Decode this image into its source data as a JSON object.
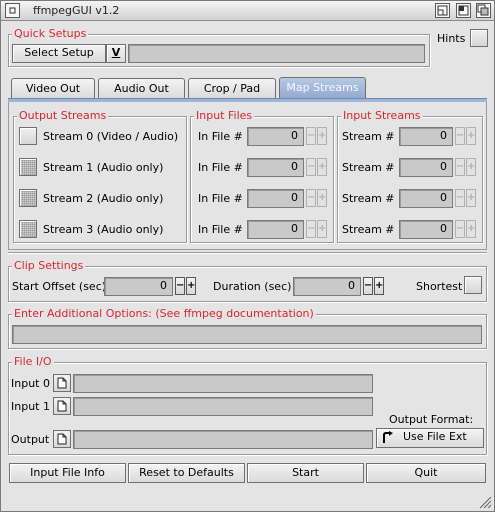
{
  "window": {
    "title": "ffmpegGUI  v1.2"
  },
  "quick_setups": {
    "title": "Quick Setups",
    "select_label": "Select Setup",
    "select_arrow": "V",
    "setup_value": "",
    "hints_label": "Hints"
  },
  "tabs": [
    {
      "label": "Video Out",
      "active": false
    },
    {
      "label": "Audio Out",
      "active": false
    },
    {
      "label": "Crop / Pad",
      "active": false
    },
    {
      "label": "Map Streams",
      "active": true
    }
  ],
  "map_streams": {
    "output_title": "Output Streams",
    "input_files_title": "Input Files",
    "input_streams_title": "Input Streams",
    "rows": [
      {
        "output": "Stream 0  (Video / Audio)",
        "file_label": "In File #",
        "file_value": "0",
        "stream_label": "Stream #",
        "stream_value": "0"
      },
      {
        "output": "Stream 1  (Audio only)",
        "file_label": "In File #",
        "file_value": "0",
        "stream_label": "Stream #",
        "stream_value": "0"
      },
      {
        "output": "Stream 2  (Audio only)",
        "file_label": "In File #",
        "file_value": "0",
        "stream_label": "Stream #",
        "stream_value": "0"
      },
      {
        "output": "Stream 3  (Audio only)",
        "file_label": "In File #",
        "file_value": "0",
        "stream_label": "Stream #",
        "stream_value": "0"
      }
    ],
    "spin_minus": "−",
    "spin_plus": "+"
  },
  "clip": {
    "title": "Clip Settings",
    "start_label": "Start Offset (sec)",
    "start_value": "0",
    "duration_label": "Duration (sec)",
    "duration_value": "0",
    "shortest_label": "Shortest",
    "minus": "−",
    "plus": "+"
  },
  "additional": {
    "title": "Enter Additional Options:    (See ffmpeg documentation)",
    "value": ""
  },
  "file_io": {
    "title": "File I/O",
    "input0_label": "Input 0",
    "input1_label": "Input 1",
    "output_label": "Output",
    "input0_value": "",
    "input1_value": "",
    "output_value": "",
    "output_format_label": "Output Format:",
    "use_file_ext_label": "Use File Ext"
  },
  "bottom": {
    "input_info": "Input File Info",
    "reset": "Reset to Defaults",
    "start": "Start",
    "quit": "Quit"
  },
  "icons": {
    "close": "close-icon",
    "iconify": "iconify-icon",
    "zoom": "zoom-icon",
    "depth": "depth-icon",
    "file": "file-icon",
    "cycle": "cycle-icon"
  },
  "colors": {
    "group_title": "#d8262d",
    "active_tab": "#9fb5d6",
    "background": "#e4e4e4"
  }
}
